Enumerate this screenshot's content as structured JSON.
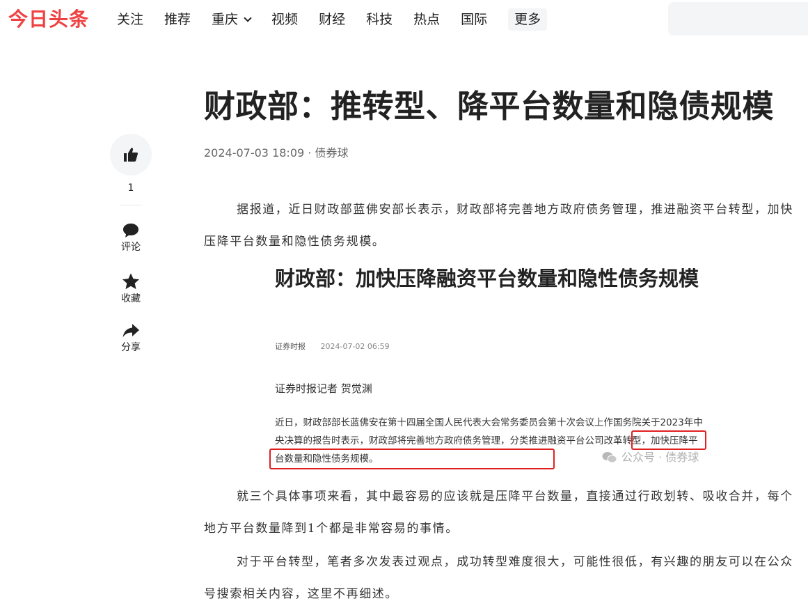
{
  "header": {
    "logo": "今日头条",
    "nav": [
      {
        "label": "关注"
      },
      {
        "label": "推荐"
      },
      {
        "label": "重庆"
      },
      {
        "label": "视频"
      },
      {
        "label": "财经"
      },
      {
        "label": "科技"
      },
      {
        "label": "热点"
      },
      {
        "label": "国际"
      }
    ],
    "more_label": "更多"
  },
  "rail": {
    "like_count": "1",
    "comment_label": "评论",
    "favorite_label": "收藏",
    "share_label": "分享"
  },
  "article": {
    "title": "财政部：推转型、降平台数量和隐债规模",
    "meta": "2024-07-03 18:09 · 债券球",
    "paragraphs": [
      "据报道，近日财政部蓝佛安部长表示，财政部将完善地方政府债务管理，推进融资平台转型，加快压降平台数量和隐性债务规模。",
      "就三个具体事项来看，其中最容易的应该就是压降平台数量，直接通过行政划转、吸收合并，每个地方平台数量降到1个都是非常容易的事情。",
      "对于平台转型，笔者多次发表过观点，成功转型难度很大，可能性很低，有兴趣的朋友可以在公众号搜索相关内容，这里不再细述。"
    ]
  },
  "embed": {
    "title": "财政部：加快压降融资平台数量和隐性债务规模",
    "source": "证券时报",
    "date": "2024-07-02 06:59",
    "reporter": "证券时报记者 贺觉渊",
    "body": "近日，财政部部长蓝佛安在第十四届全国人民代表大会常务委员会第十次会议上作国务院关于2023年中央决算的报告时表示，财政部将完善地方政府债务管理，分类推进融资平台公司改革转型，加快压降平台数量和隐性债务规模。",
    "watermark": "公众号 · 债券球"
  },
  "colors": {
    "brand": "#f04142",
    "highlight_box": "#e02020"
  }
}
